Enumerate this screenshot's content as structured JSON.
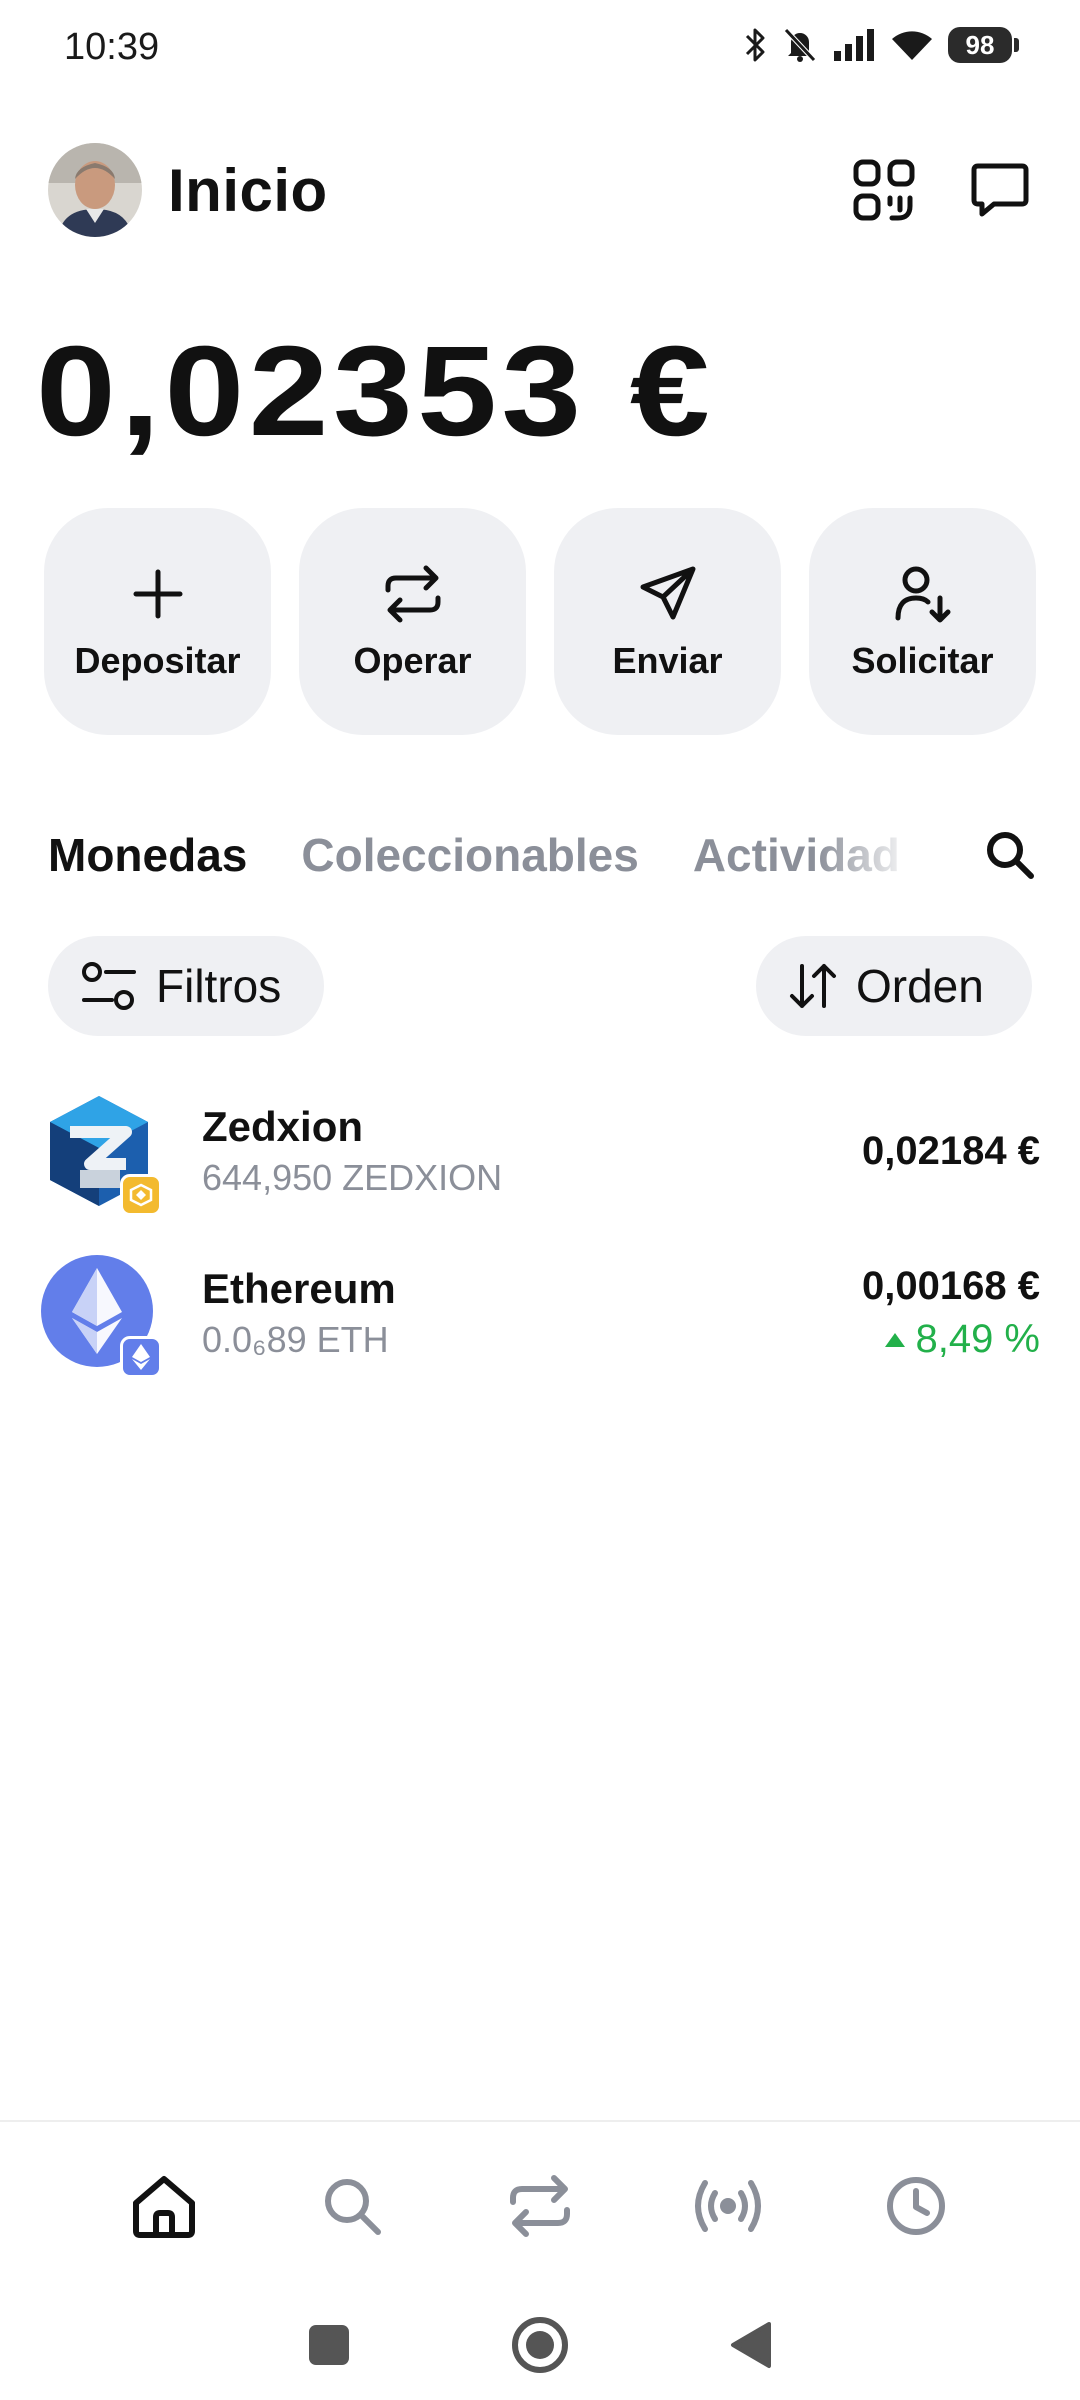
{
  "status_bar": {
    "time": "10:39",
    "battery": "98"
  },
  "header": {
    "title": "Inicio"
  },
  "balance": "0,02353 €",
  "actions": [
    {
      "label": "Depositar",
      "icon": "plus-icon"
    },
    {
      "label": "Operar",
      "icon": "swap-icon"
    },
    {
      "label": "Enviar",
      "icon": "send-icon"
    },
    {
      "label": "Solicitar",
      "icon": "request-icon"
    }
  ],
  "tabs": [
    {
      "label": "Monedas",
      "active": true
    },
    {
      "label": "Coleccionables",
      "active": false
    },
    {
      "label": "Actividad",
      "active": false
    }
  ],
  "filters": {
    "filter_label": "Filtros",
    "sort_label": "Orden"
  },
  "assets": [
    {
      "name": "Zedxion",
      "amount": "644,950 ZEDXION",
      "value": "0,02184 €",
      "change": ""
    },
    {
      "name": "Ethereum",
      "amount": "0.0₆89 ETH",
      "value": "0,00168 €",
      "change": "8,49 %"
    }
  ],
  "colors": {
    "accent_green": "#22b04a",
    "muted_text": "#8b8f99",
    "chip_bg": "#eff0f3",
    "eth_blue": "#627eea",
    "bnb_yellow": "#f3ba2f"
  },
  "bottom_nav": [
    "home-icon",
    "search-icon",
    "swap-icon",
    "broadcast-icon",
    "clock-icon"
  ]
}
